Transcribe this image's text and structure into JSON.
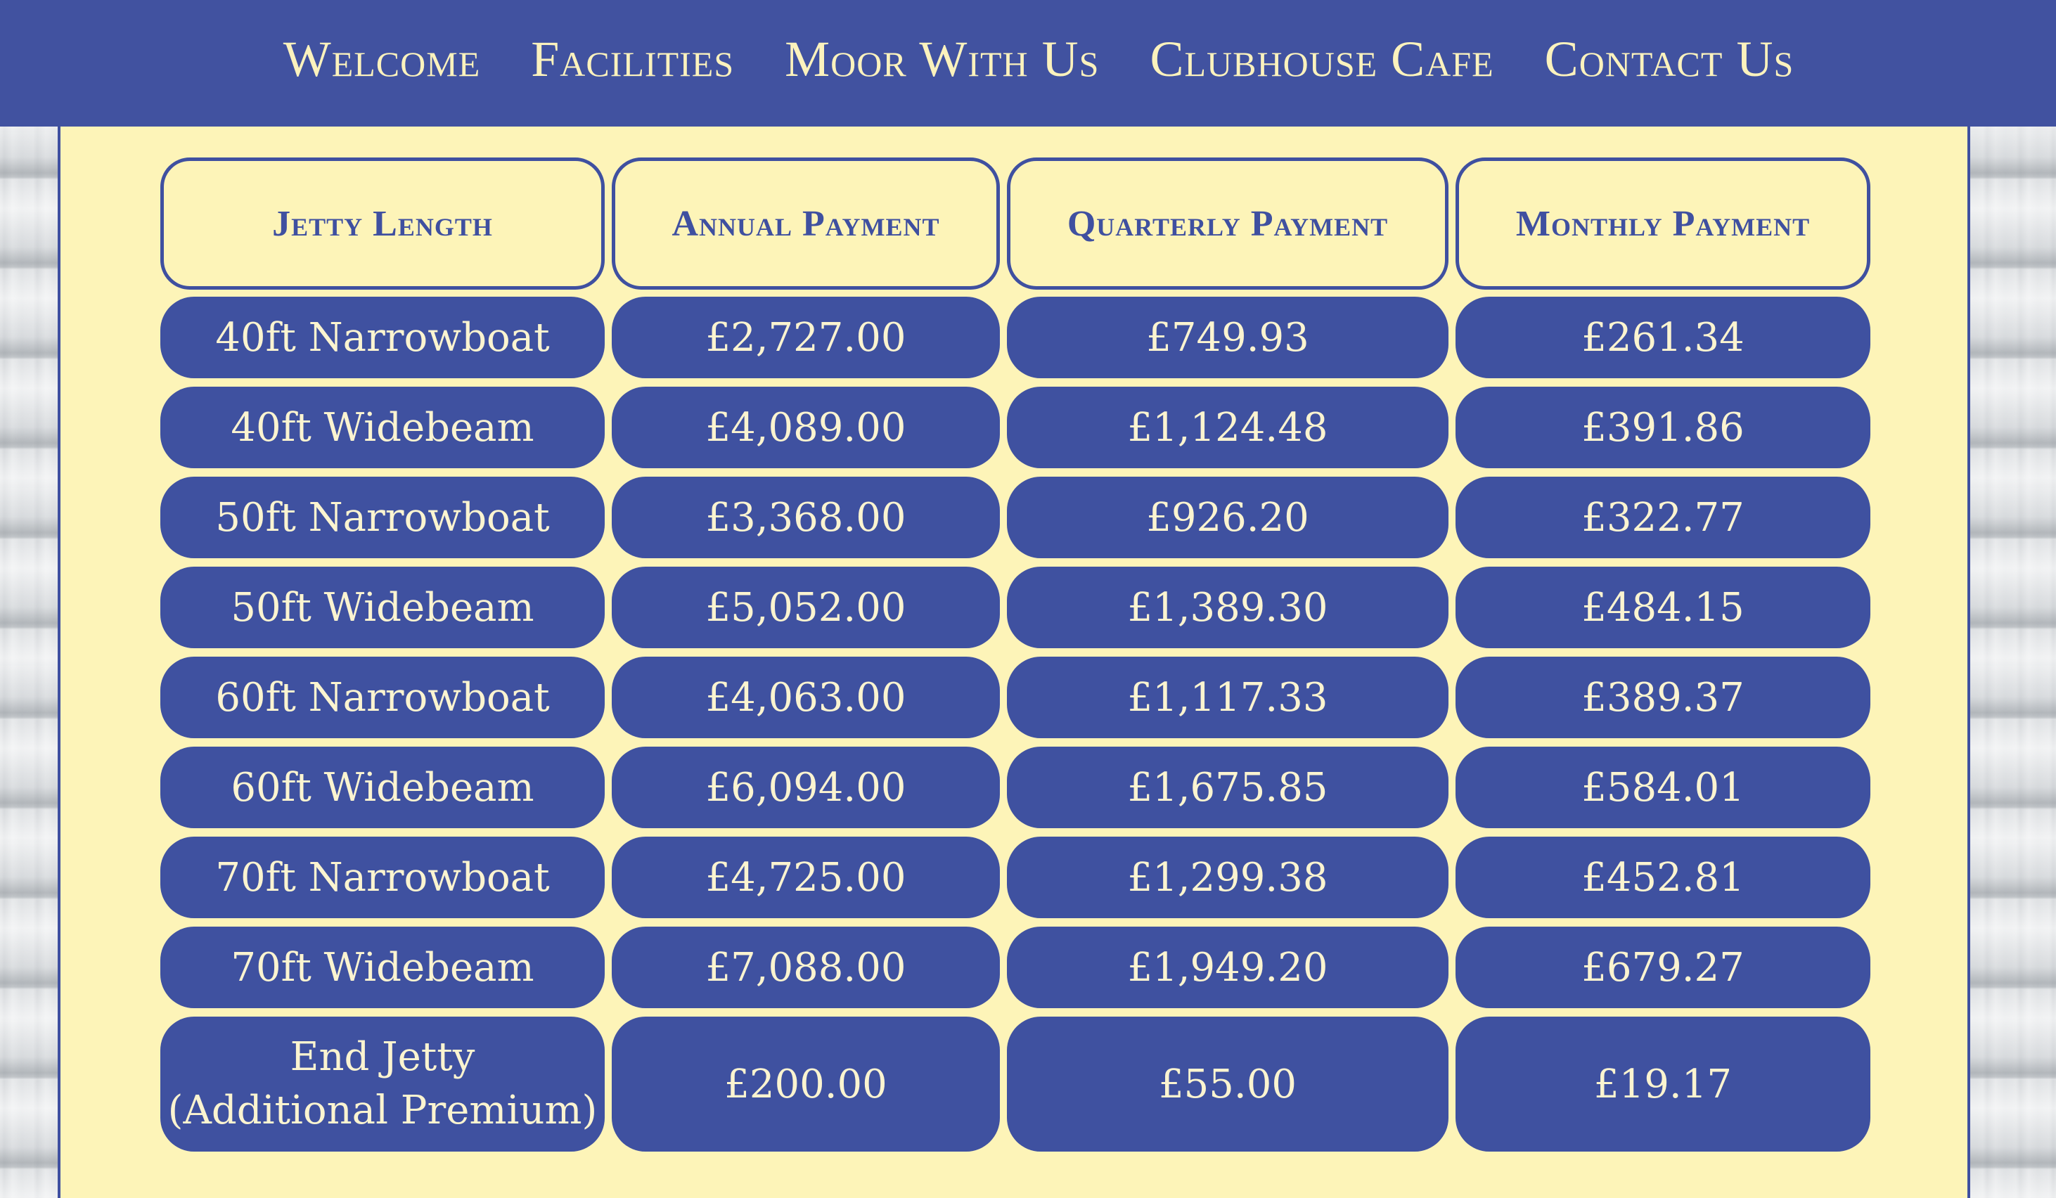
{
  "nav": {
    "items": [
      "Welcome",
      "Facilities",
      "Moor With Us",
      "Clubhouse Cafe",
      "Contact Us"
    ]
  },
  "table": {
    "headers": [
      "Jetty Length",
      "Annual Payment",
      "Quarterly Payment",
      "Monthly Payment"
    ],
    "rows": [
      {
        "length": "40ft Narrowboat",
        "annual": "£2,727.00",
        "quarterly": "£749.93",
        "monthly": "£261.34"
      },
      {
        "length": "40ft Widebeam",
        "annual": "£4,089.00",
        "quarterly": "£1,124.48",
        "monthly": "£391.86"
      },
      {
        "length": "50ft Narrowboat",
        "annual": "£3,368.00",
        "quarterly": "£926.20",
        "monthly": "£322.77"
      },
      {
        "length": "50ft Widebeam",
        "annual": "£5,052.00",
        "quarterly": "£1,389.30",
        "monthly": "£484.15"
      },
      {
        "length": "60ft Narrowboat",
        "annual": "£4,063.00",
        "quarterly": "£1,117.33",
        "monthly": "£389.37"
      },
      {
        "length": "60ft Widebeam",
        "annual": "£6,094.00",
        "quarterly": "£1,675.85",
        "monthly": "£584.01"
      },
      {
        "length": "70ft Narrowboat",
        "annual": "£4,725.00",
        "quarterly": "£1,299.38",
        "monthly": "£452.81"
      },
      {
        "length": "70ft Widebeam",
        "annual": "£7,088.00",
        "quarterly": "£1,949.20",
        "monthly": "£679.27"
      },
      {
        "length_line1": "End Jetty",
        "length_line2": "(Additional Premium)",
        "annual": "£200.00",
        "quarterly": "£55.00",
        "monthly": "£19.17"
      }
    ]
  },
  "colors": {
    "navy": "#4152a0",
    "cream": "#fdf4b8",
    "cell_text": "#fbf4d0"
  }
}
